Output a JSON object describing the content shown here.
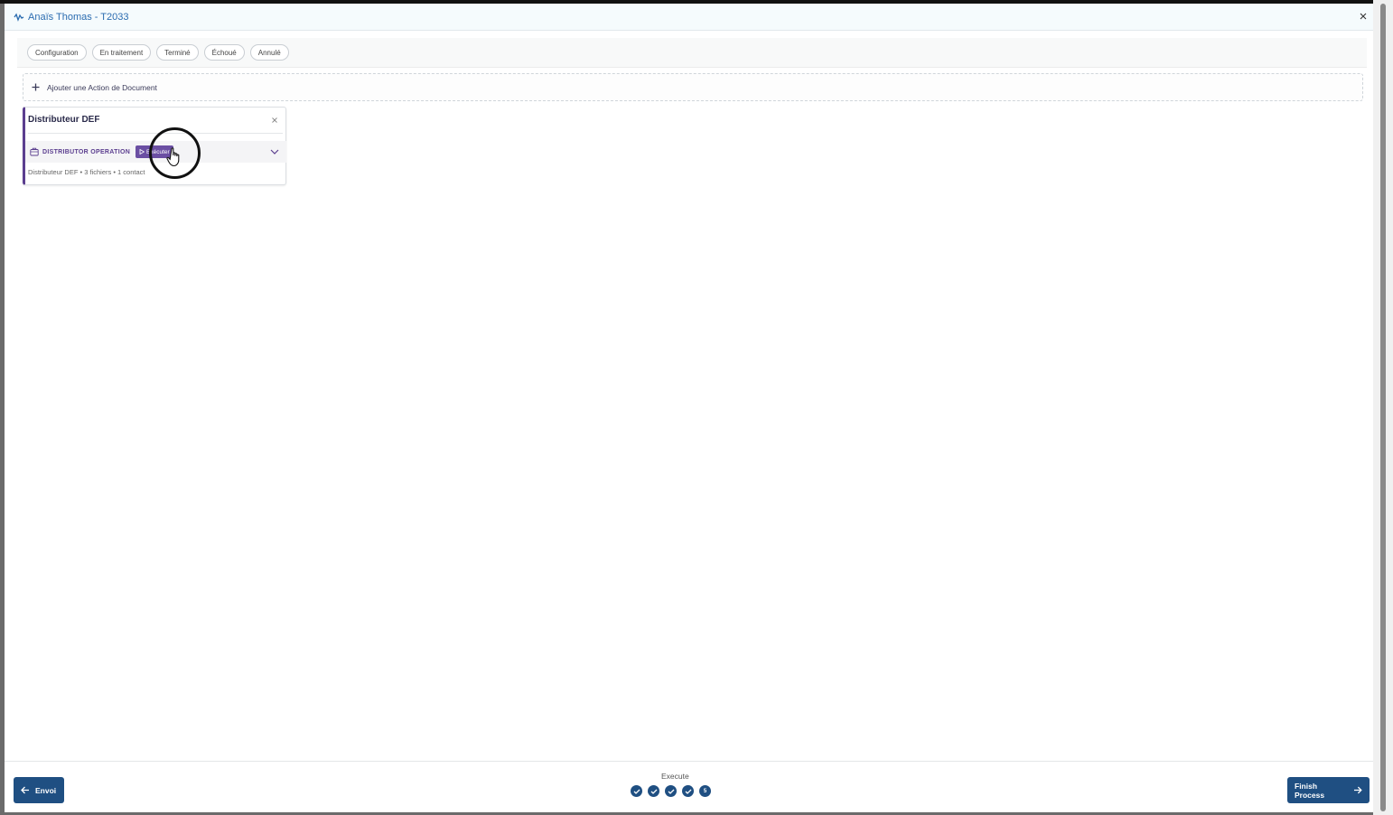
{
  "header": {
    "title": "Anaïs Thomas - T2033"
  },
  "filters": [
    {
      "label": "Configuration"
    },
    {
      "label": "En traitement"
    },
    {
      "label": "Terminé"
    },
    {
      "label": "Échoué"
    },
    {
      "label": "Annulé"
    }
  ],
  "add_action": {
    "label": "Ajouter une Action de Document"
  },
  "card": {
    "title": "Distributeur DEF",
    "operation_label": "DISTRIBUTOR OPERATION",
    "execute_label": "Exécuter",
    "meta": "Distributeur DEF • 3 fichiers • 1 contact"
  },
  "footer": {
    "back_label": "Envoi",
    "finish_label": "Finish Process",
    "stepper_label": "Execute",
    "steps": [
      {
        "state": "done"
      },
      {
        "state": "done"
      },
      {
        "state": "done"
      },
      {
        "state": "done"
      },
      {
        "state": "current",
        "label": "5"
      }
    ]
  },
  "colors": {
    "primary": "#1f4f82",
    "accent": "#5b3e8f",
    "header_title": "#2b6cb0"
  },
  "icons": {
    "header": "process-icon",
    "close": "close-icon",
    "add": "plus-icon",
    "operation": "briefcase-icon",
    "chevron": "chevron-down-icon",
    "back": "arrow-left-icon",
    "finish": "arrow-right-icon",
    "step_done": "check-icon"
  }
}
